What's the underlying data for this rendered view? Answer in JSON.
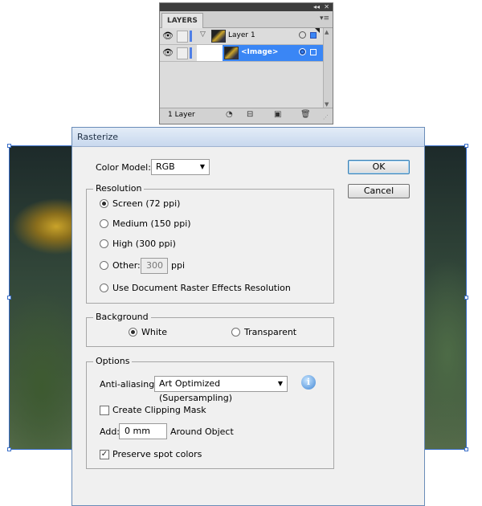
{
  "layers_panel": {
    "tab_label": "LAYERS",
    "collapse_glyph": "◂◂",
    "close_glyph": "✕",
    "menu_glyph": "▾≡",
    "rows": [
      {
        "name": "Layer 1",
        "expand_glyph": "▽",
        "selected": false
      },
      {
        "name": "<Image>",
        "selected": true
      }
    ],
    "footer_count": "1 Layer",
    "icons": [
      "make-clipping-mask-icon",
      "create-sublayer-icon",
      "new-layer-icon",
      "delete-icon"
    ],
    "accent": "#3a86f5"
  },
  "dialog": {
    "title": "Rasterize",
    "color_model_label": "Color Model:",
    "color_model_value": "RGB",
    "ok_label": "OK",
    "cancel_label": "Cancel",
    "resolution": {
      "legend": "Resolution",
      "options": [
        "Screen (72 ppi)",
        "Medium (150 ppi)",
        "High (300 ppi)",
        "Other:",
        "Use Document Raster Effects Resolution"
      ],
      "selected_index": 0,
      "other_value": "300",
      "other_unit": "ppi"
    },
    "background": {
      "legend": "Background",
      "white_label": "White",
      "transparent_label": "Transparent",
      "selected": "White"
    },
    "options": {
      "legend": "Options",
      "antialias_label": "Anti-aliasing:",
      "antialias_value": "Art Optimized (Supersampling)",
      "info_glyph": "i",
      "clipping_mask_label": "Create Clipping Mask",
      "clipping_mask_checked": false,
      "add_label": "Add:",
      "add_value": "0 mm",
      "around_label": "Around Object",
      "preserve_spot_label": "Preserve spot colors",
      "preserve_spot_checked": true,
      "check_glyph": "✓"
    }
  }
}
